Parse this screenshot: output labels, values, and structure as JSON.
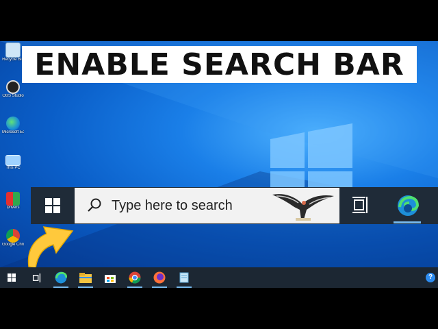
{
  "title": {
    "text": "ENABLE SEARCH BAR"
  },
  "desktop_icons": [
    {
      "label": "Recycle Bin",
      "icon": "recycle-bin-icon"
    },
    {
      "label": "OBS Studio",
      "icon": "obs-studio-icon"
    },
    {
      "label": "Microsoft Edge",
      "icon": "edge-icon"
    },
    {
      "label": "This PC",
      "icon": "this-pc-icon"
    },
    {
      "label": "Drivers",
      "icon": "drivers-icon"
    },
    {
      "label": "Google Chrome",
      "icon": "chrome-icon"
    }
  ],
  "zoomed_taskbar": {
    "search_placeholder": "Type here to search",
    "icons": [
      "windows-start-icon",
      "search-icon",
      "condor-bird-icon",
      "task-view-icon",
      "edge-icon"
    ]
  },
  "taskbar": {
    "items": [
      {
        "name": "start",
        "icon": "windows-start-icon"
      },
      {
        "name": "task-view",
        "icon": "task-view-icon"
      },
      {
        "name": "edge",
        "icon": "edge-icon",
        "active": true
      },
      {
        "name": "file-explorer",
        "icon": "folder-icon",
        "active": true
      },
      {
        "name": "store",
        "icon": "store-icon"
      },
      {
        "name": "chrome",
        "icon": "chrome-icon",
        "active": true
      },
      {
        "name": "firefox",
        "icon": "firefox-icon",
        "active": true
      },
      {
        "name": "notepad",
        "icon": "notepad-icon",
        "active": true
      }
    ],
    "help": "?"
  },
  "colors": {
    "taskbar": "#1c2733",
    "desktop": "#0a5ec8",
    "accent": "#76b9ed",
    "arrow": "#ffc93c"
  }
}
